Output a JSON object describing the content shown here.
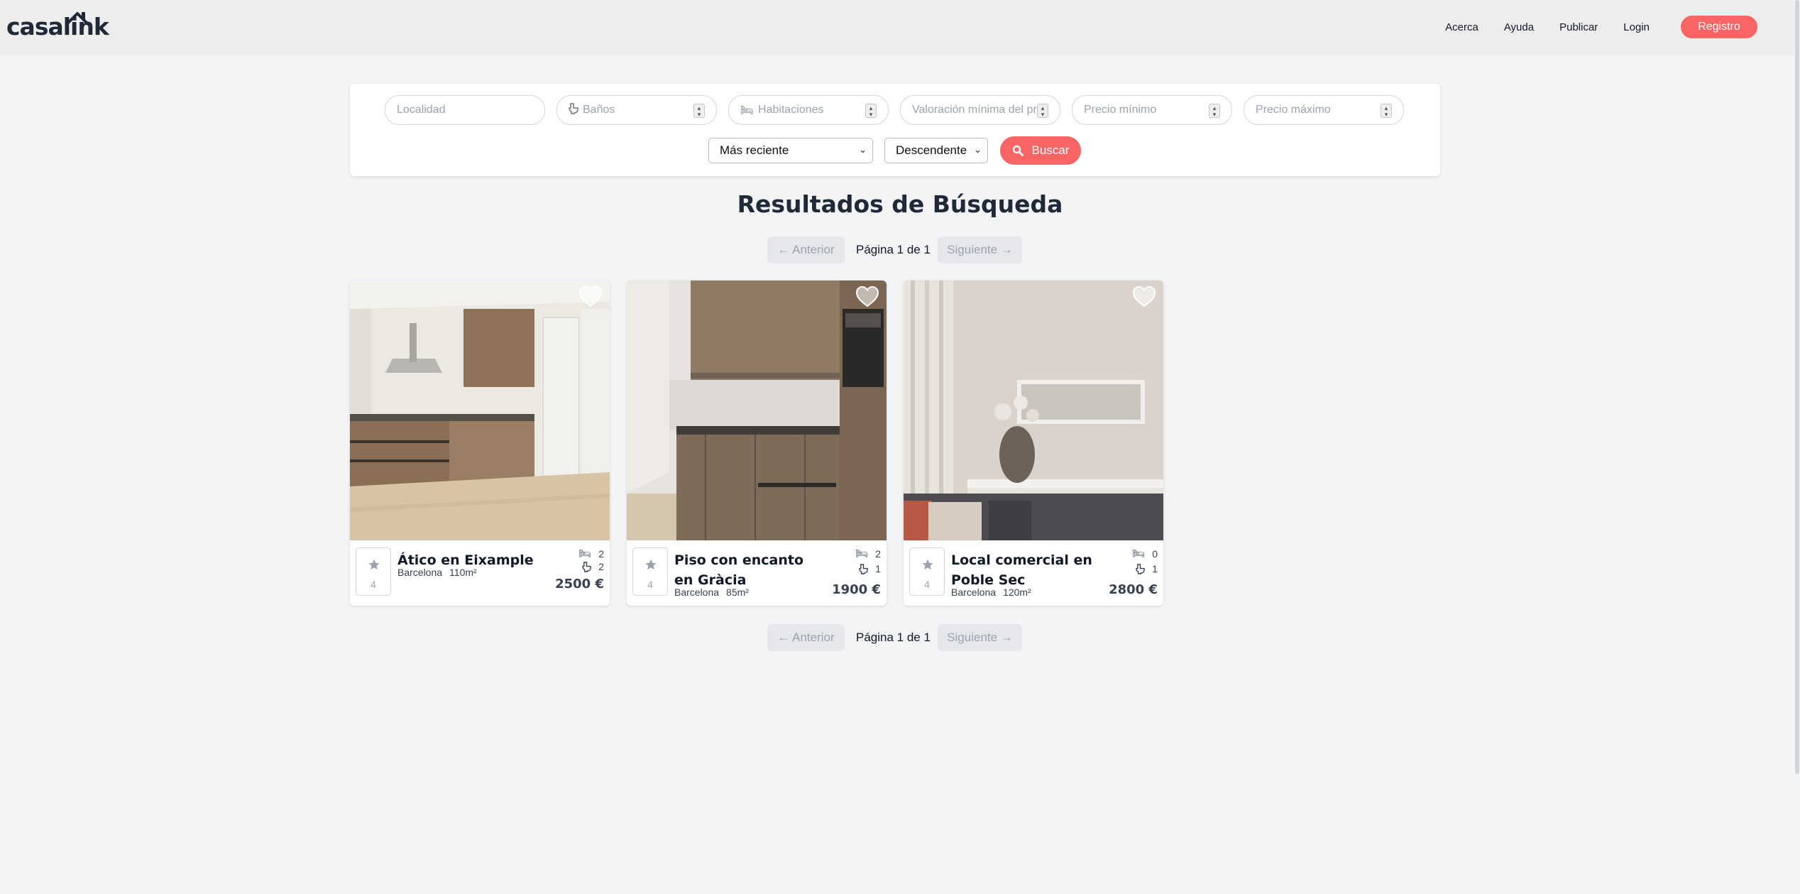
{
  "header": {
    "logo_text": "casalink",
    "nav": [
      "Acerca",
      "Ayuda",
      "Publicar",
      "Login"
    ],
    "register_label": "Registro"
  },
  "search": {
    "locality_placeholder": "Localidad",
    "baths_placeholder": "Baños",
    "rooms_placeholder": "Habitaciones",
    "rating_placeholder": "Valoración mínima del pr",
    "min_price_placeholder": "Precio mínimo",
    "max_price_placeholder": "Precio máximo",
    "sort_by": "Más reciente",
    "order": "Descendente",
    "button_label": "Buscar",
    "accent_color": "#f96464"
  },
  "results": {
    "title": "Resultados de Búsqueda"
  },
  "pagination": {
    "prev_label": "← Anterior",
    "next_label": "Siguiente →",
    "page_text": "Página 1 de 1"
  },
  "listings": [
    {
      "title": "Ático en Eixample",
      "city": "Barcelona",
      "area": "110m²",
      "bedrooms": "2",
      "bathrooms": "2",
      "price": "2500 €",
      "rating": "4",
      "favorite": false
    },
    {
      "title": "Piso con encanto en Gràcia",
      "city": "Barcelona",
      "area": "85m²",
      "bedrooms": "2",
      "bathrooms": "1",
      "price": "1900 €",
      "rating": "4",
      "favorite": false
    },
    {
      "title": "Local comercial en Poble Sec",
      "city": "Barcelona",
      "area": "120m²",
      "bedrooms": "0",
      "bathrooms": "1",
      "price": "2800 €",
      "rating": "4",
      "favorite": false
    }
  ]
}
